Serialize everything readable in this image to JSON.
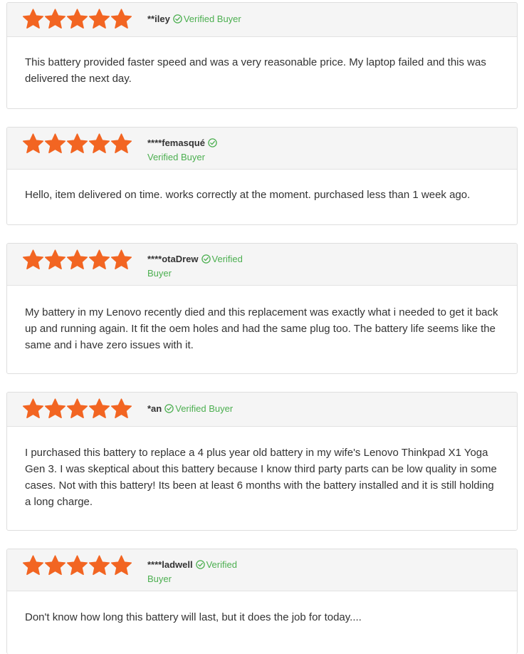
{
  "colors": {
    "star": "#f26522",
    "verified": "#4caf50",
    "header_bg": "#f5f5f5",
    "border": "#dedede",
    "text": "#333333"
  },
  "icons": {
    "star": "star-icon",
    "verified": "check-circle-icon"
  },
  "reviews": [
    {
      "rating": 5,
      "reviewer": "**iley",
      "verified_label": "Verified Buyer",
      "text": "This battery provided faster speed and was a very reasonable price. My laptop failed and this was delivered the next day."
    },
    {
      "rating": 5,
      "reviewer": "****femasqué",
      "verified_label": "Verified Buyer",
      "text": "Hello, item delivered on time. works correctly at the moment. purchased less than 1 week ago."
    },
    {
      "rating": 5,
      "reviewer": "****otaDrew",
      "verified_label": "Verified Buyer",
      "text": "My battery in my Lenovo recently died and this replacement was exactly what i needed to get it back up and running again. It fit the oem holes and had the same plug too. The battery life seems like the same and i have zero issues with it."
    },
    {
      "rating": 5,
      "reviewer": "*an",
      "verified_label": "Verified Buyer",
      "text": "I purchased this battery to replace a 4 plus year old battery in my wife's Lenovo Thinkpad X1 Yoga Gen 3. I was skeptical about this battery because I know third party parts can be low quality in some cases. Not with this battery! Its been at least 6 months with the battery installed and it is still holding a long charge."
    },
    {
      "rating": 5,
      "reviewer": "****ladwell",
      "verified_label": "Verified Buyer",
      "text": "Don't know how long this battery will last, but it does the job for today...."
    }
  ]
}
